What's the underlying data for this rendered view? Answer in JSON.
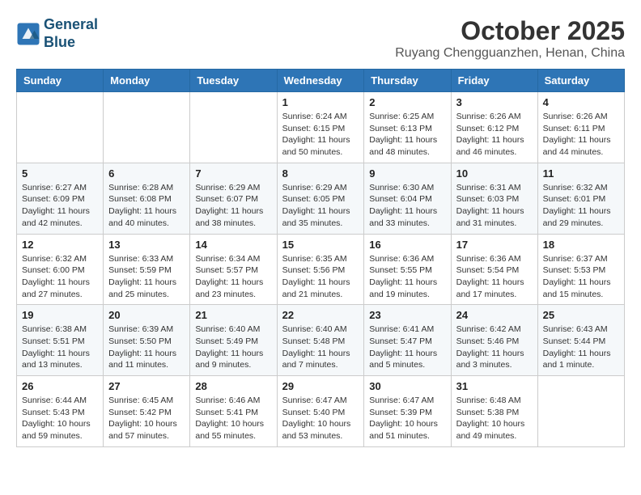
{
  "header": {
    "logo_line1": "General",
    "logo_line2": "Blue",
    "month_title": "October 2025",
    "subtitle": "Ruyang Chengguanzhen, Henan, China"
  },
  "weekdays": [
    "Sunday",
    "Monday",
    "Tuesday",
    "Wednesday",
    "Thursday",
    "Friday",
    "Saturday"
  ],
  "weeks": [
    [
      {
        "day": "",
        "info": ""
      },
      {
        "day": "",
        "info": ""
      },
      {
        "day": "",
        "info": ""
      },
      {
        "day": "1",
        "info": "Sunrise: 6:24 AM\nSunset: 6:15 PM\nDaylight: 11 hours\nand 50 minutes."
      },
      {
        "day": "2",
        "info": "Sunrise: 6:25 AM\nSunset: 6:13 PM\nDaylight: 11 hours\nand 48 minutes."
      },
      {
        "day": "3",
        "info": "Sunrise: 6:26 AM\nSunset: 6:12 PM\nDaylight: 11 hours\nand 46 minutes."
      },
      {
        "day": "4",
        "info": "Sunrise: 6:26 AM\nSunset: 6:11 PM\nDaylight: 11 hours\nand 44 minutes."
      }
    ],
    [
      {
        "day": "5",
        "info": "Sunrise: 6:27 AM\nSunset: 6:09 PM\nDaylight: 11 hours\nand 42 minutes."
      },
      {
        "day": "6",
        "info": "Sunrise: 6:28 AM\nSunset: 6:08 PM\nDaylight: 11 hours\nand 40 minutes."
      },
      {
        "day": "7",
        "info": "Sunrise: 6:29 AM\nSunset: 6:07 PM\nDaylight: 11 hours\nand 38 minutes."
      },
      {
        "day": "8",
        "info": "Sunrise: 6:29 AM\nSunset: 6:05 PM\nDaylight: 11 hours\nand 35 minutes."
      },
      {
        "day": "9",
        "info": "Sunrise: 6:30 AM\nSunset: 6:04 PM\nDaylight: 11 hours\nand 33 minutes."
      },
      {
        "day": "10",
        "info": "Sunrise: 6:31 AM\nSunset: 6:03 PM\nDaylight: 11 hours\nand 31 minutes."
      },
      {
        "day": "11",
        "info": "Sunrise: 6:32 AM\nSunset: 6:01 PM\nDaylight: 11 hours\nand 29 minutes."
      }
    ],
    [
      {
        "day": "12",
        "info": "Sunrise: 6:32 AM\nSunset: 6:00 PM\nDaylight: 11 hours\nand 27 minutes."
      },
      {
        "day": "13",
        "info": "Sunrise: 6:33 AM\nSunset: 5:59 PM\nDaylight: 11 hours\nand 25 minutes."
      },
      {
        "day": "14",
        "info": "Sunrise: 6:34 AM\nSunset: 5:57 PM\nDaylight: 11 hours\nand 23 minutes."
      },
      {
        "day": "15",
        "info": "Sunrise: 6:35 AM\nSunset: 5:56 PM\nDaylight: 11 hours\nand 21 minutes."
      },
      {
        "day": "16",
        "info": "Sunrise: 6:36 AM\nSunset: 5:55 PM\nDaylight: 11 hours\nand 19 minutes."
      },
      {
        "day": "17",
        "info": "Sunrise: 6:36 AM\nSunset: 5:54 PM\nDaylight: 11 hours\nand 17 minutes."
      },
      {
        "day": "18",
        "info": "Sunrise: 6:37 AM\nSunset: 5:53 PM\nDaylight: 11 hours\nand 15 minutes."
      }
    ],
    [
      {
        "day": "19",
        "info": "Sunrise: 6:38 AM\nSunset: 5:51 PM\nDaylight: 11 hours\nand 13 minutes."
      },
      {
        "day": "20",
        "info": "Sunrise: 6:39 AM\nSunset: 5:50 PM\nDaylight: 11 hours\nand 11 minutes."
      },
      {
        "day": "21",
        "info": "Sunrise: 6:40 AM\nSunset: 5:49 PM\nDaylight: 11 hours\nand 9 minutes."
      },
      {
        "day": "22",
        "info": "Sunrise: 6:40 AM\nSunset: 5:48 PM\nDaylight: 11 hours\nand 7 minutes."
      },
      {
        "day": "23",
        "info": "Sunrise: 6:41 AM\nSunset: 5:47 PM\nDaylight: 11 hours\nand 5 minutes."
      },
      {
        "day": "24",
        "info": "Sunrise: 6:42 AM\nSunset: 5:46 PM\nDaylight: 11 hours\nand 3 minutes."
      },
      {
        "day": "25",
        "info": "Sunrise: 6:43 AM\nSunset: 5:44 PM\nDaylight: 11 hours\nand 1 minute."
      }
    ],
    [
      {
        "day": "26",
        "info": "Sunrise: 6:44 AM\nSunset: 5:43 PM\nDaylight: 10 hours\nand 59 minutes."
      },
      {
        "day": "27",
        "info": "Sunrise: 6:45 AM\nSunset: 5:42 PM\nDaylight: 10 hours\nand 57 minutes."
      },
      {
        "day": "28",
        "info": "Sunrise: 6:46 AM\nSunset: 5:41 PM\nDaylight: 10 hours\nand 55 minutes."
      },
      {
        "day": "29",
        "info": "Sunrise: 6:47 AM\nSunset: 5:40 PM\nDaylight: 10 hours\nand 53 minutes."
      },
      {
        "day": "30",
        "info": "Sunrise: 6:47 AM\nSunset: 5:39 PM\nDaylight: 10 hours\nand 51 minutes."
      },
      {
        "day": "31",
        "info": "Sunrise: 6:48 AM\nSunset: 5:38 PM\nDaylight: 10 hours\nand 49 minutes."
      },
      {
        "day": "",
        "info": ""
      }
    ]
  ]
}
